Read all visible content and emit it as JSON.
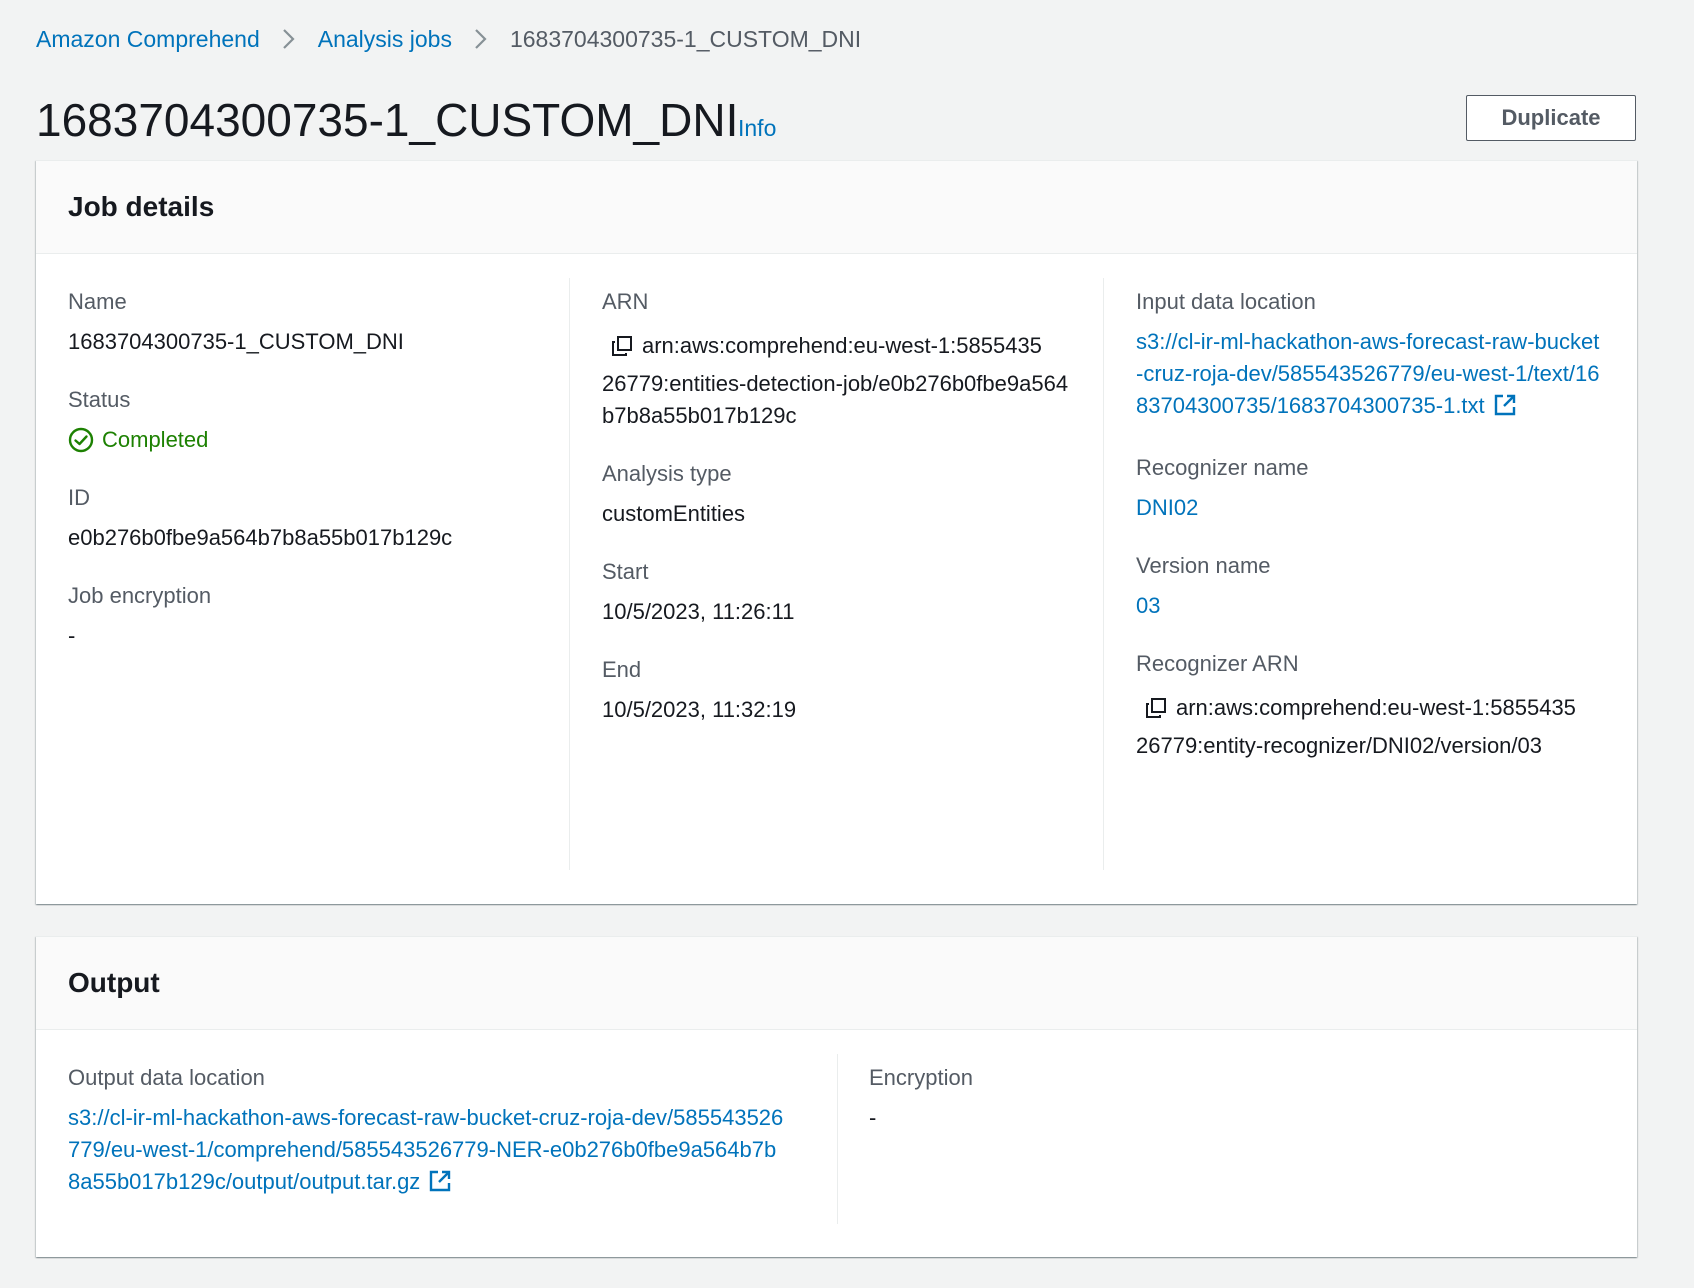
{
  "breadcrumb": {
    "items": [
      {
        "label": "Amazon Comprehend"
      },
      {
        "label": "Analysis jobs"
      },
      {
        "label": "1683704300735-1_CUSTOM_DNI"
      }
    ]
  },
  "header": {
    "title": "1683704300735-1_CUSTOM_DNI",
    "info_label": "Info",
    "duplicate_label": "Duplicate"
  },
  "job_details": {
    "title": "Job details",
    "name_label": "Name",
    "name_value": "1683704300735-1_CUSTOM_DNI",
    "status_label": "Status",
    "status_value": "Completed",
    "id_label": "ID",
    "id_value": "e0b276b0fbe9a564b7b8a55b017b129c",
    "encryption_label": "Job encryption",
    "encryption_value": "-",
    "arn_label": "ARN",
    "arn_line1": "arn:aws:comprehend:eu-west-1:5855435",
    "arn_line2": "26779:entities-detection-job/e0b276b0fbe9a564b7b8a55b017b129c",
    "analysis_type_label": "Analysis type",
    "analysis_type_value": "customEntities",
    "start_label": "Start",
    "start_value": "10/5/2023, 11:26:11",
    "end_label": "End",
    "end_value": "10/5/2023, 11:32:19",
    "input_label": "Input data location",
    "input_value": "s3://cl-ir-ml-hackathon-aws-forecast-raw-bucket-cruz-roja-dev/585543526779/eu-west-1/text/1683704300735/1683704300735-1.txt",
    "recognizer_name_label": "Recognizer name",
    "recognizer_name_value": "DNI02",
    "version_name_label": "Version name",
    "version_name_value": "03",
    "recognizer_arn_label": "Recognizer ARN",
    "recognizer_arn_line1": "arn:aws:comprehend:eu-west-1:5855435",
    "recognizer_arn_line2": "26779:entity-recognizer/DNI02/version/03"
  },
  "output": {
    "title": "Output",
    "output_location_label": "Output data location",
    "output_location_value": "s3://cl-ir-ml-hackathon-aws-forecast-raw-bucket-cruz-roja-dev/585543526779/eu-west-1/comprehend/585543526779-NER-e0b276b0fbe9a564b7b8a55b017b129c/output/output.tar.gz",
    "encryption_label": "Encryption",
    "encryption_value": "-"
  },
  "colors": {
    "link": "#0073bb",
    "success": "#1d8102",
    "text": "#16191f",
    "label": "#545b64",
    "background": "#f2f3f3"
  },
  "icons": [
    "chevron-right-icon",
    "status-success-icon",
    "copy-icon",
    "external-link-icon"
  ]
}
